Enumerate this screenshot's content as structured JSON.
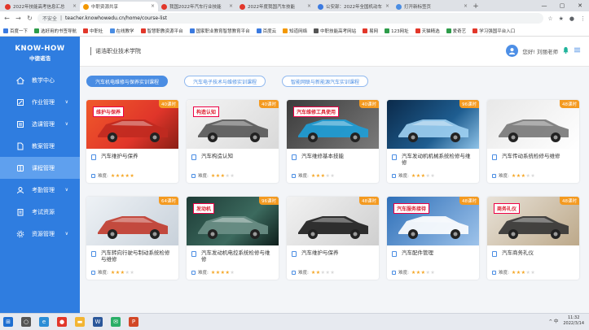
{
  "browser": {
    "tabs": [
      {
        "title": "2022年技能高考信息汇总",
        "color": "#e2372a"
      },
      {
        "title": "中职资源共享",
        "color": "#f39800"
      },
      {
        "title": "我国2022年汽车行业技能",
        "color": "#e2372a"
      },
      {
        "title": "2022年度我国汽车技能",
        "color": "#e2372a"
      },
      {
        "title": "公安部：2022年全国机动车",
        "color": "#3b7ae0"
      },
      {
        "title": "打开新标签页",
        "color": "#4a8de3"
      }
    ],
    "active_tab": 1,
    "new_tab_label": "+",
    "security_label": "不安全",
    "url": "teacher.knowhowedu.cn/home/course-list",
    "window_controls": [
      "—",
      "▢",
      "✕"
    ],
    "nav": {
      "back": "←",
      "forward": "→",
      "reload": "↻"
    },
    "right_icons": {
      "star": "☆",
      "bookmarks": "★",
      "profile": "●",
      "menu": "⋮"
    },
    "bookmarks": [
      {
        "label": "百度一下",
        "color": "#3b7ae0"
      },
      {
        "label": "选好用的书签导航",
        "color": "#2e9c4a"
      },
      {
        "label": "中职社",
        "color": "#e2372a"
      },
      {
        "label": "在线教学",
        "color": "#4a8de3"
      },
      {
        "label": "智慧职教资源平台",
        "color": "#e2372a"
      },
      {
        "label": "国家职业教育智慧教育平台",
        "color": "#3b7ae0"
      },
      {
        "label": "百度云",
        "color": "#3b7ae0"
      },
      {
        "label": "知道网络",
        "color": "#f39800"
      },
      {
        "label": "中职技能高考网站",
        "color": "#555555"
      },
      {
        "label": "易网",
        "color": "#e2372a"
      },
      {
        "label": "123网址",
        "color": "#2e9c4a"
      },
      {
        "label": "天猫精选",
        "color": "#e2372a"
      },
      {
        "label": "爱奇艺",
        "color": "#2e9c4a"
      },
      {
        "label": "学习强国平台入口",
        "color": "#e2372a"
      }
    ]
  },
  "sidebar": {
    "logo_en": "KNOW-HOW",
    "logo_cn": "中德诺浩",
    "items": [
      {
        "label": "教学中心",
        "icon": "home-icon",
        "chevron": false,
        "active": false
      },
      {
        "label": "作业管理",
        "icon": "edit-icon",
        "chevron": true,
        "active": false
      },
      {
        "label": "选课管理",
        "icon": "list-icon",
        "chevron": true,
        "active": false
      },
      {
        "label": "教案管理",
        "icon": "file-icon",
        "chevron": false,
        "active": false
      },
      {
        "label": "课程管理",
        "icon": "book-icon",
        "chevron": false,
        "active": true
      },
      {
        "label": "考勤管理",
        "icon": "user-icon",
        "chevron": true,
        "active": false
      },
      {
        "label": "考试资源",
        "icon": "clipboard-icon",
        "chevron": false,
        "active": false
      },
      {
        "label": "资源管理",
        "icon": "gear-icon",
        "chevron": true,
        "active": false
      }
    ]
  },
  "header": {
    "title": "诺浩职业技术学院",
    "greeting": "您好! 刘丽老师",
    "icons": {
      "bell": "bell-icon",
      "menu": "menu-icon"
    }
  },
  "course_tabs": [
    {
      "label": "汽车机电维修与保养实训课程",
      "active": true
    },
    {
      "label": "汽车电子技术与维修实训课程",
      "active": false
    },
    {
      "label": "智能网联与新能源汽车实训课程",
      "active": false
    }
  ],
  "difficulty_label": "难度:",
  "courses": [
    {
      "name": "汽车维护与保养",
      "hours": "40课时",
      "banner": "维护与保养",
      "rating": 5,
      "bg": "linear-gradient(135deg,#f05a2a 0%,#e0352a 60%,#8a1f15 100%)",
      "car": "#c02a20"
    },
    {
      "name": "汽车构造认知",
      "hours": "40课时",
      "banner": "构造认知",
      "rating": 3,
      "bg": "linear-gradient(135deg,#f4f4f4 0%,#d9d9d9 100%)",
      "car": "#555555"
    },
    {
      "name": "汽车维修基本技能",
      "hours": "40课时",
      "banner": "汽车维修工具使用",
      "rating": 3,
      "bg": "linear-gradient(135deg,#3b3b3b 0%,#7a7a7a 100%)",
      "car": "#1d9fd8"
    },
    {
      "name": "汽车发动机机械系统检修与维修",
      "hours": "96课时",
      "banner": "",
      "rating": 3,
      "bg": "linear-gradient(135deg,#0b2a4a 0%,#1e5d90 60%,#8fc3e8 100%)",
      "car": "#9fd0f2"
    },
    {
      "name": "汽车传动系统检修与维修",
      "hours": "48课时",
      "banner": "",
      "rating": 3,
      "bg": "linear-gradient(135deg,#e8e8e8 0%,#ffffff 100%)",
      "car": "#777777"
    },
    {
      "name": "汽车转向行驶与制动系统检修与维修",
      "hours": "64课时",
      "banner": "",
      "rating": 3,
      "bg": "linear-gradient(135deg,#eef2f6 0%,#c8d1da 100%)",
      "car": "#c0392b"
    },
    {
      "name": "汽车发动机电控系统检修与维修",
      "hours": "96课时",
      "banner": "发动机",
      "rating": 4,
      "bg": "linear-gradient(135deg,#1d3b36 0%,#3c6a5e 60%,#0e1e1b 100%)",
      "car": "#6b8f86"
    },
    {
      "name": "汽车维护与保养",
      "hours": "48课时",
      "banner": "",
      "rating": 2,
      "bg": "linear-gradient(135deg,#f2f2f2 0%,#cfcfcf 100%)",
      "car": "#1b1b1b"
    },
    {
      "name": "汽车配件管理",
      "hours": "48课时",
      "banner": "汽车服务接待",
      "rating": 3,
      "bg": "linear-gradient(135deg,#2e6fb8 0%,#9ec3ea 100%)",
      "car": "#ffffff"
    },
    {
      "name": "汽车商务礼仪",
      "hours": "48课时",
      "banner": "商务礼仪",
      "rating": 3,
      "bg": "linear-gradient(135deg,#e8e2d8 0%,#bda98a 100%)",
      "car": "#333333"
    }
  ],
  "taskbar": {
    "apps": [
      {
        "name": "start-icon",
        "color": "#1f6fd1",
        "glyph": "⊞"
      },
      {
        "name": "search-icon",
        "color": "#555555",
        "glyph": "○"
      },
      {
        "name": "edge-icon",
        "color": "#2b8dd6",
        "glyph": "e"
      },
      {
        "name": "chrome-icon",
        "color": "#e2372a",
        "glyph": "●"
      },
      {
        "name": "folder-icon",
        "color": "#f3b533",
        "glyph": "▬"
      },
      {
        "name": "word-icon",
        "color": "#2b579a",
        "glyph": "W"
      },
      {
        "name": "wechat-icon",
        "color": "#2aae67",
        "glyph": "✉"
      },
      {
        "name": "powerpoint-icon",
        "color": "#d24726",
        "glyph": "P"
      }
    ],
    "tray_text": "^ 中",
    "time": "11:32",
    "date": "2022/3/14"
  }
}
